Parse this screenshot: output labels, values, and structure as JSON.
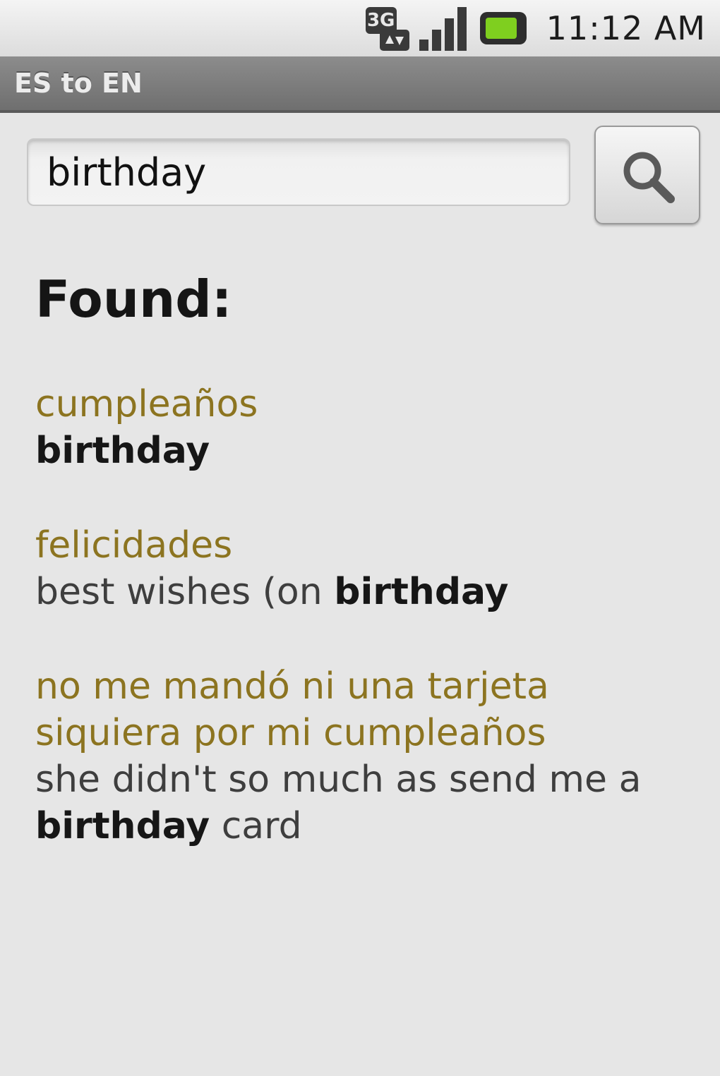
{
  "status_bar": {
    "network_icon": "3g-data-icon",
    "network_label": "3G",
    "signal_icon": "signal-strength-icon",
    "battery_icon": "battery-charging-icon",
    "time": "11:12 AM"
  },
  "title_bar": {
    "title": "ES to EN"
  },
  "search": {
    "value": "birthday",
    "button_icon": "search-icon"
  },
  "results": {
    "heading": "Found:",
    "entries": [
      {
        "source": "cumpleaños",
        "target_pre": "",
        "target_bold": "birthday",
        "target_post": ""
      },
      {
        "source": "felicidades",
        "target_pre": "best wishes (on ",
        "target_bold": "birthday",
        "target_post": ""
      },
      {
        "source": "no me mandó ni una tarjeta siquiera por mi cumpleaños",
        "target_pre": "she didn't so much as send me a ",
        "target_bold": "birthday",
        "target_post": " card"
      }
    ]
  },
  "colors": {
    "source_text": "#8c7420",
    "target_text": "#3e3e3e",
    "title_bar": "#7d7d7d",
    "background": "#e6e6e6",
    "battery_fill": "#7fcf1f"
  }
}
